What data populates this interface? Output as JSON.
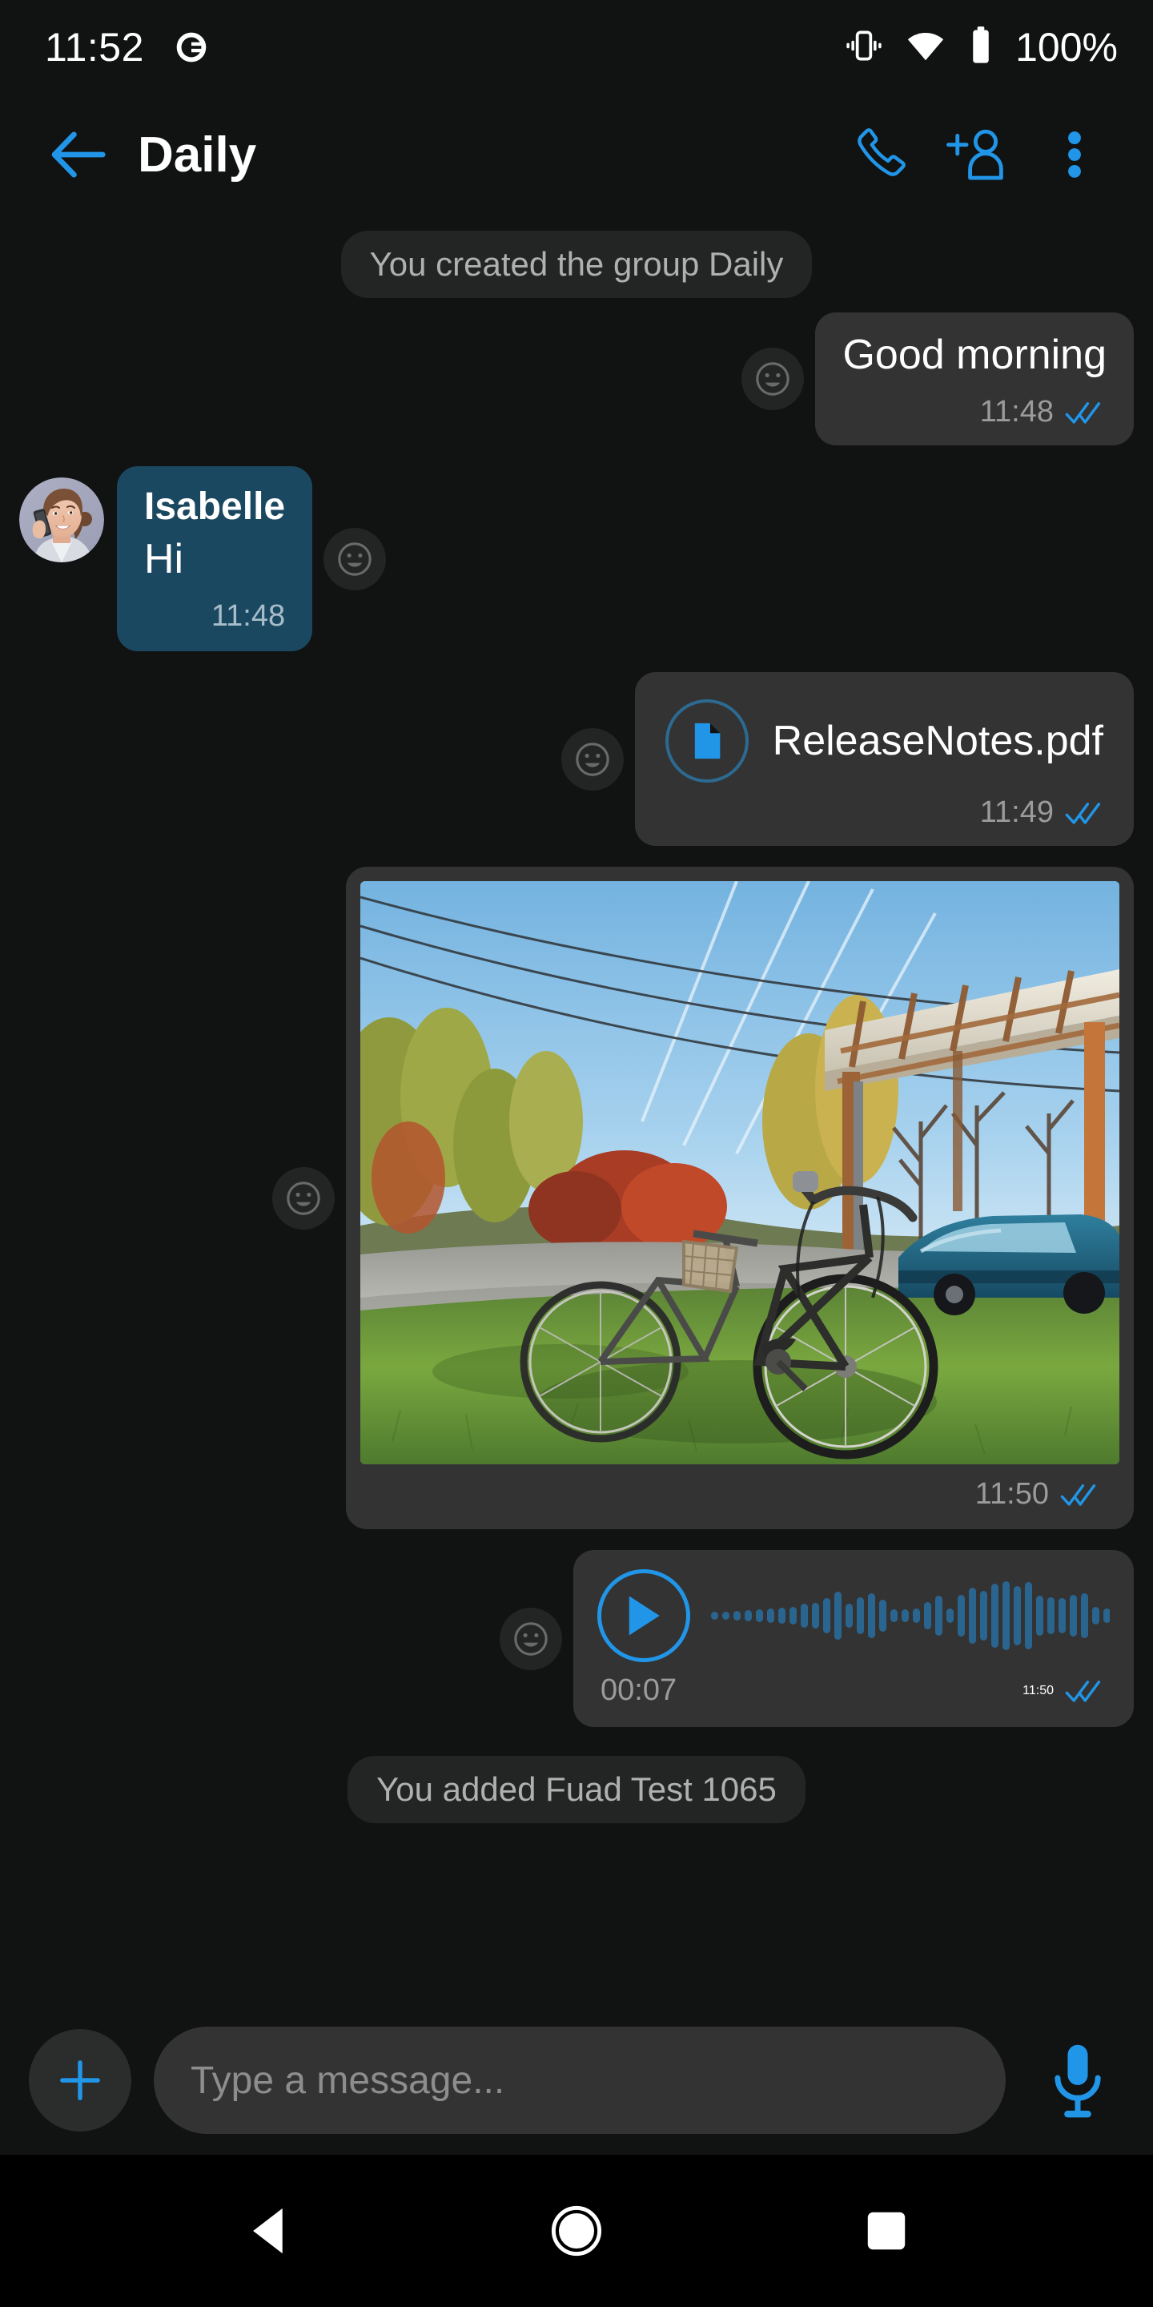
{
  "status_bar": {
    "time": "11:52",
    "app_logo_icon": "app-logo-icon",
    "vibrate_icon": "vibrate-icon",
    "wifi_icon": "wifi-icon",
    "battery_icon": "battery-icon",
    "battery_text": "100%"
  },
  "app_bar": {
    "back_icon": "back-arrow-icon",
    "title": "Daily",
    "call_icon": "phone-call-icon",
    "add_member_icon": "add-person-icon",
    "overflow_icon": "overflow-menu-icon"
  },
  "conversation": {
    "system_message_top": "You created the group Daily",
    "system_message_bottom": "You added Fuad Test 1065",
    "messages": [
      {
        "id": "msg-good-morning",
        "direction": "out",
        "type": "text",
        "text": "Good morning",
        "time": "11:48",
        "status": "read",
        "react_icon": "emoji-reaction-icon"
      },
      {
        "id": "msg-isabelle-hi",
        "direction": "in",
        "type": "text",
        "sender": "Isabelle",
        "text": "Hi",
        "time": "11:48",
        "avatar_icon": "avatar-isabelle",
        "react_icon": "emoji-reaction-icon"
      },
      {
        "id": "msg-release-notes",
        "direction": "out",
        "type": "file",
        "file_name": "ReleaseNotes.pdf",
        "file_icon": "pdf-document-icon",
        "time": "11:49",
        "status": "read",
        "react_icon": "emoji-reaction-icon"
      },
      {
        "id": "msg-photo-bicycles",
        "direction": "out",
        "type": "image",
        "image_icon": "photo-bicycles-autumn",
        "time": "11:50",
        "status": "read",
        "react_icon": "emoji-reaction-icon"
      },
      {
        "id": "msg-voice-note",
        "direction": "out",
        "type": "voice",
        "play_icon": "play-button-icon",
        "waveform_icon": "audio-waveform",
        "duration": "00:07",
        "time": "11:50",
        "status": "read",
        "react_icon": "emoji-reaction-icon"
      }
    ]
  },
  "input_bar": {
    "attach_icon": "plus-attach-icon",
    "placeholder": "Type a message...",
    "mic_icon": "microphone-icon"
  },
  "nav_bar": {
    "back_icon": "nav-back-icon",
    "home_icon": "nav-home-icon",
    "recents_icon": "nav-recents-icon"
  },
  "colors": {
    "accent": "#2196e8",
    "incoming_bubble": "#1b4861",
    "outgoing_bubble": "#333333",
    "background": "#111212",
    "system_bubble": "#232424",
    "waveform": "#2a6590",
    "muted_text": "#9b9b9b"
  },
  "waveform_bars": [
    10,
    10,
    12,
    14,
    16,
    18,
    20,
    22,
    30,
    32,
    44,
    60,
    30,
    46,
    56,
    40,
    16,
    16,
    18,
    34,
    50,
    18,
    52,
    70,
    62,
    80,
    86,
    74,
    84,
    50,
    46,
    44,
    52,
    56,
    22,
    18,
    50,
    54,
    48,
    16,
    16,
    16,
    58,
    64,
    26,
    16,
    42,
    46,
    18,
    14,
    34
  ]
}
